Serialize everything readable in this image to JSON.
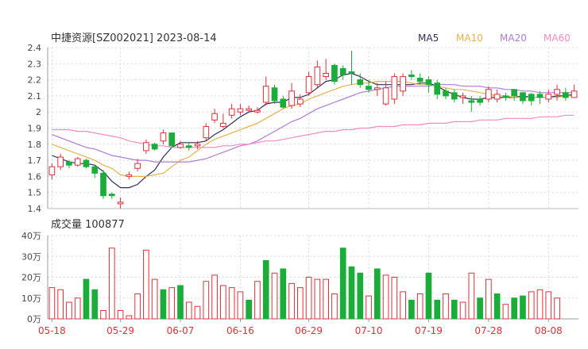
{
  "header": {
    "title": "中捷资源[SZ002021] 2023-08-14"
  },
  "legend": [
    {
      "name": "MA5",
      "color": "#2f2f5a"
    },
    {
      "name": "MA10",
      "color": "#e8b04b"
    },
    {
      "name": "MA20",
      "color": "#b07ad8"
    },
    {
      "name": "MA60",
      "color": "#f08cbe"
    }
  ],
  "volume_title": "成交量 100877",
  "colors": {
    "up": "#e0303a",
    "down": "#1aad3a",
    "grid": "#d8d8d8",
    "axis": "#444444"
  },
  "chart_data": [
    {
      "type": "candlestick",
      "title": "中捷资源[SZ002021] 2023-08-14",
      "ylim": [
        1.4,
        2.4
      ],
      "y_ticks": [
        "2.4",
        "2.3",
        "2.2",
        "2.1",
        "2",
        "1.9",
        "1.8",
        "1.7",
        "1.6",
        "1.5",
        "1.4"
      ],
      "x_tick_labels": [
        "05-18",
        "05-29",
        "06-07",
        "06-16",
        "06-29",
        "07-10",
        "07-19",
        "07-28",
        "08-08"
      ],
      "x_tick_indices": [
        0,
        8,
        15,
        22,
        30,
        37,
        44,
        51,
        58
      ],
      "dates": [
        "05-18",
        "05-19",
        "05-22",
        "05-23",
        "05-24",
        "05-25",
        "05-26",
        "05-29",
        "05-30",
        "05-31",
        "06-01",
        "06-02",
        "06-05",
        "06-06",
        "06-07",
        "06-08",
        "06-09",
        "06-12",
        "06-13",
        "06-14",
        "06-15",
        "06-16",
        "06-19",
        "06-20",
        "06-21",
        "06-26",
        "06-27",
        "06-28",
        "06-29",
        "06-30",
        "07-03",
        "07-04",
        "07-05",
        "07-06",
        "07-07",
        "07-10",
        "07-11",
        "07-12",
        "07-13",
        "07-14",
        "07-17",
        "07-18",
        "07-19",
        "07-20",
        "07-21",
        "07-24",
        "07-25",
        "07-26",
        "07-27",
        "07-28",
        "07-31",
        "08-01",
        "08-02",
        "08-03",
        "08-04",
        "08-07",
        "08-08",
        "08-09",
        "08-10",
        "08-11",
        "08-14"
      ],
      "open": [
        1.61,
        1.66,
        1.69,
        1.67,
        1.7,
        1.66,
        1.62,
        1.49,
        1.43,
        1.6,
        1.65,
        1.76,
        1.8,
        1.82,
        1.87,
        1.78,
        1.79,
        1.79,
        1.84,
        1.95,
        1.91,
        1.98,
        2.0,
        2.01,
        2.0,
        2.06,
        2.15,
        2.08,
        2.04,
        2.05,
        2.12,
        2.17,
        2.22,
        2.29,
        2.27,
        2.25,
        2.2,
        2.16,
        2.14,
        2.05,
        2.08,
        2.13,
        2.23,
        2.21,
        2.2,
        2.18,
        2.13,
        2.12,
        2.09,
        2.07,
        2.08,
        2.08,
        2.08,
        2.1,
        2.14,
        2.12,
        2.11,
        2.11,
        2.08,
        2.11,
        2.12,
        2.09
      ],
      "close": [
        1.66,
        1.72,
        1.67,
        1.71,
        1.66,
        1.62,
        1.48,
        1.48,
        1.44,
        1.61,
        1.68,
        1.81,
        1.77,
        1.87,
        1.79,
        1.8,
        1.78,
        1.8,
        1.91,
        1.99,
        1.93,
        2.02,
        2.02,
        2.02,
        2.01,
        2.16,
        2.07,
        2.03,
        2.13,
        2.08,
        2.22,
        2.28,
        2.24,
        2.19,
        2.23,
        2.24,
        2.17,
        2.14,
        2.15,
        2.15,
        2.22,
        2.22,
        2.22,
        2.19,
        2.17,
        2.11,
        2.1,
        2.08,
        2.1,
        2.06,
        2.06,
        2.14,
        2.11,
        2.09,
        2.1,
        2.07,
        2.07,
        2.09,
        2.11,
        2.14,
        2.09,
        2.13
      ],
      "high": [
        1.68,
        1.74,
        1.7,
        1.72,
        1.71,
        1.67,
        1.64,
        1.5,
        1.47,
        1.63,
        1.71,
        1.83,
        1.81,
        1.89,
        1.87,
        1.82,
        1.81,
        1.82,
        1.93,
        2.02,
        1.99,
        2.05,
        2.05,
        2.04,
        2.03,
        2.22,
        2.17,
        2.1,
        2.18,
        2.11,
        2.25,
        2.32,
        2.33,
        2.3,
        2.29,
        2.38,
        2.24,
        2.2,
        2.18,
        2.19,
        2.24,
        2.24,
        2.26,
        2.24,
        2.22,
        2.2,
        2.15,
        2.14,
        2.12,
        2.1,
        2.1,
        2.16,
        2.14,
        2.12,
        2.13,
        2.12,
        2.12,
        2.13,
        2.14,
        2.17,
        2.15,
        2.17
      ],
      "low": [
        1.58,
        1.64,
        1.65,
        1.66,
        1.65,
        1.59,
        1.46,
        1.46,
        1.4,
        1.58,
        1.63,
        1.74,
        1.76,
        1.8,
        1.78,
        1.77,
        1.76,
        1.77,
        1.82,
        1.93,
        1.9,
        1.96,
        1.98,
        2.0,
        1.99,
        2.04,
        2.05,
        2.02,
        2.02,
        2.03,
        2.1,
        2.15,
        2.2,
        2.17,
        2.2,
        2.17,
        2.15,
        2.12,
        2.1,
        2.04,
        2.05,
        2.1,
        2.2,
        2.17,
        2.12,
        2.08,
        2.08,
        2.06,
        2.05,
        2.0,
        2.04,
        2.06,
        2.06,
        2.07,
        2.07,
        2.05,
        2.04,
        2.05,
        2.06,
        2.07,
        2.07,
        2.09
      ],
      "ma5": [
        1.73,
        1.71,
        1.69,
        1.68,
        1.68,
        1.67,
        1.63,
        1.57,
        1.53,
        1.53,
        1.55,
        1.6,
        1.64,
        1.72,
        1.78,
        1.81,
        1.81,
        1.81,
        1.82,
        1.86,
        1.89,
        1.93,
        1.97,
        2.0,
        2.01,
        2.05,
        2.06,
        2.06,
        2.09,
        2.09,
        2.11,
        2.15,
        2.19,
        2.2,
        2.23,
        2.24,
        2.22,
        2.19,
        2.17,
        2.17,
        2.17,
        2.17,
        2.17,
        2.18,
        2.18,
        2.16,
        2.13,
        2.11,
        2.09,
        2.08,
        2.08,
        2.09,
        2.09,
        2.09,
        2.09,
        2.1,
        2.09,
        2.09,
        2.09,
        2.1,
        2.1,
        2.11
      ],
      "ma10": [
        1.8,
        1.78,
        1.76,
        1.74,
        1.72,
        1.7,
        1.67,
        1.65,
        1.61,
        1.6,
        1.6,
        1.6,
        1.61,
        1.62,
        1.66,
        1.7,
        1.72,
        1.76,
        1.8,
        1.83,
        1.85,
        1.87,
        1.89,
        1.91,
        1.93,
        1.96,
        1.99,
        2.02,
        2.04,
        2.05,
        2.08,
        2.1,
        2.12,
        2.14,
        2.16,
        2.17,
        2.18,
        2.18,
        2.19,
        2.19,
        2.19,
        2.19,
        2.18,
        2.17,
        2.17,
        2.16,
        2.15,
        2.14,
        2.14,
        2.13,
        2.12,
        2.11,
        2.1,
        2.1,
        2.09,
        2.09,
        2.09,
        2.09,
        2.09,
        2.09,
        2.1,
        2.1
      ],
      "ma20": [
        1.86,
        1.84,
        1.82,
        1.8,
        1.78,
        1.77,
        1.75,
        1.73,
        1.72,
        1.71,
        1.7,
        1.7,
        1.69,
        1.69,
        1.69,
        1.69,
        1.69,
        1.7,
        1.71,
        1.73,
        1.75,
        1.77,
        1.79,
        1.8,
        1.82,
        1.85,
        1.88,
        1.91,
        1.94,
        1.96,
        1.99,
        2.02,
        2.04,
        2.06,
        2.08,
        2.1,
        2.12,
        2.13,
        2.14,
        2.15,
        2.16,
        2.16,
        2.16,
        2.16,
        2.16,
        2.17,
        2.17,
        2.17,
        2.16,
        2.16,
        2.16,
        2.15,
        2.15,
        2.14,
        2.14,
        2.13,
        2.13,
        2.12,
        2.12,
        2.12,
        2.12,
        2.12
      ],
      "ma60": [
        1.89,
        1.89,
        1.89,
        1.88,
        1.88,
        1.87,
        1.86,
        1.85,
        1.84,
        1.82,
        1.81,
        1.8,
        1.79,
        1.79,
        1.78,
        1.78,
        1.78,
        1.78,
        1.78,
        1.78,
        1.79,
        1.79,
        1.8,
        1.8,
        1.81,
        1.82,
        1.82,
        1.83,
        1.84,
        1.85,
        1.86,
        1.87,
        1.88,
        1.88,
        1.89,
        1.89,
        1.9,
        1.9,
        1.91,
        1.91,
        1.91,
        1.92,
        1.92,
        1.92,
        1.93,
        1.93,
        1.93,
        1.94,
        1.94,
        1.94,
        1.95,
        1.95,
        1.95,
        1.96,
        1.96,
        1.96,
        1.96,
        1.97,
        1.97,
        1.97,
        1.98,
        1.98
      ]
    },
    {
      "type": "bar",
      "title": "成交量 100877",
      "ylim": [
        0,
        40
      ],
      "y_ticks": [
        "40万",
        "30万",
        "20万",
        "10万",
        "0万"
      ],
      "unit": "万",
      "values": [
        15,
        14,
        8,
        10,
        19,
        14,
        4,
        34,
        4,
        1.5,
        12,
        33,
        19,
        14,
        15,
        16,
        8,
        6,
        18,
        21,
        16,
        15,
        13,
        9,
        18,
        28,
        22,
        24,
        17,
        15,
        20,
        19,
        19,
        12,
        34,
        25,
        22,
        11,
        24,
        21,
        20,
        13,
        9,
        12,
        22,
        9,
        12,
        9,
        8,
        22,
        10,
        19,
        12,
        7,
        10,
        11,
        13,
        14,
        13,
        10
      ],
      "up": [
        true,
        true,
        true,
        true,
        false,
        false,
        true,
        true,
        true,
        true,
        true,
        true,
        true,
        false,
        true,
        false,
        true,
        true,
        true,
        true,
        true,
        true,
        true,
        false,
        true,
        false,
        true,
        false,
        true,
        true,
        true,
        true,
        true,
        true,
        false,
        false,
        false,
        true,
        false,
        true,
        true,
        true,
        false,
        true,
        false,
        false,
        true,
        false,
        true,
        true,
        false,
        true,
        false,
        true,
        false,
        false,
        true,
        true,
        true,
        true,
        false
      ]
    }
  ]
}
